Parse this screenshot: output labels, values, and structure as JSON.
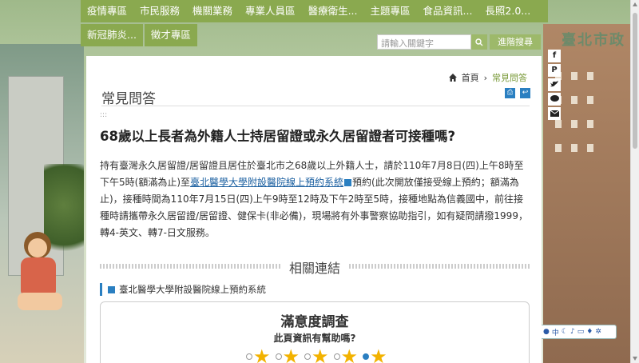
{
  "nav": {
    "row1": [
      "疫情專區",
      "市民服務",
      "機關業務",
      "專業人員區",
      "醫療衛生...",
      "主題專區",
      "食品資訊...",
      "長照2.0..."
    ],
    "row2": [
      "新冠肺炎...",
      "徵才專區"
    ]
  },
  "search": {
    "placeholder": "請輸入關鍵字",
    "advanced_label": "進階搜尋"
  },
  "logo_text": "臺北市政",
  "breadcrumb": {
    "home": "首頁",
    "separator": "›",
    "current": "常見問答"
  },
  "page_title": "常見問答",
  "dots": ":::",
  "question": {
    "title": "68歲以上長者為外籍人士持居留證或永久居留證者可接種嗎?",
    "body_before": "持有臺灣永久居留證/居留證且居住於臺北市之68歲以上外籍人士，請於110年7月8日(四)上午8時至下午5時(額滿為止)至",
    "link_text": "臺北醫學大學附設醫院線上預約系統",
    "body_after": "預約(此次開放僅接受線上預約；額滿為止)，接種時間為110年7月15日(四)上午9時至12時及下午2時至5時，接種地點為信義國中，前往接種時請攜帶永久居留證/居留證、健保卡(非必備)，現場將有外事警察協助指引，如有疑問請撥1999，轉4-英文、轉7-日文服務。"
  },
  "related": {
    "heading": "相關連結",
    "items": [
      "臺北醫學大學附設醫院線上預約系統"
    ]
  },
  "survey": {
    "title": "滿意度調查",
    "question": "此頁資訊有幫助嗎?",
    "star_count": 5,
    "selected": 4
  },
  "share_icons": [
    "f",
    "P",
    "tw",
    "line",
    "mail"
  ],
  "colors": {
    "nav_green": "#8aa94f",
    "link_blue": "#1a5fa0",
    "accent": "#2a7fc1",
    "star": "#f2b200"
  }
}
